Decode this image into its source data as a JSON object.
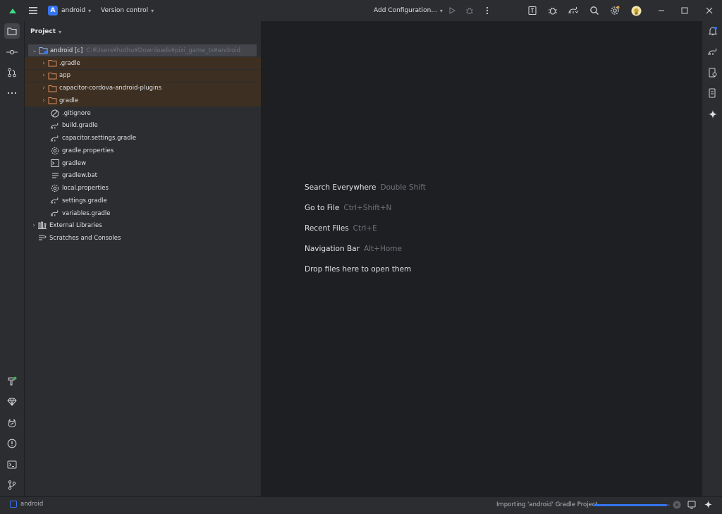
{
  "titlebar": {
    "project_letter": "A",
    "project_name": "android",
    "version_control": "Version control",
    "run_config": "Add Configuration..."
  },
  "project_panel": {
    "title": "Project",
    "root": {
      "label": "android [c]",
      "path": "C:¥Users¥hothu¥Downloads¥pixi_game_ts¥android"
    },
    "items": [
      {
        "label": ".gradle",
        "type": "folder"
      },
      {
        "label": "app",
        "type": "folder"
      },
      {
        "label": "capacitor-cordova-android-plugins",
        "type": "folder"
      },
      {
        "label": "gradle",
        "type": "folder"
      },
      {
        "label": ".gitignore",
        "type": "ignore"
      },
      {
        "label": "build.gradle",
        "type": "gradle"
      },
      {
        "label": "capacitor.settings.gradle",
        "type": "gradle"
      },
      {
        "label": "gradle.properties",
        "type": "properties"
      },
      {
        "label": "gradlew",
        "type": "shell"
      },
      {
        "label": "gradlew.bat",
        "type": "text"
      },
      {
        "label": "local.properties",
        "type": "properties"
      },
      {
        "label": "settings.gradle",
        "type": "gradle"
      },
      {
        "label": "variables.gradle",
        "type": "gradle"
      }
    ],
    "external_libraries": "External Libraries",
    "scratches": "Scratches and Consoles"
  },
  "editor": {
    "hints": [
      {
        "action": "Search Everywhere",
        "shortcut": "Double Shift"
      },
      {
        "action": "Go to File",
        "shortcut": "Ctrl+Shift+N"
      },
      {
        "action": "Recent Files",
        "shortcut": "Ctrl+E"
      },
      {
        "action": "Navigation Bar",
        "shortcut": "Alt+Home"
      },
      {
        "action": "Drop files here to open them",
        "shortcut": ""
      }
    ]
  },
  "statusbar": {
    "breadcrumb": "android",
    "task": "Importing 'android' Gradle Project",
    "progress": 0.96
  },
  "colors": {
    "accent": "#3574f0",
    "folder_excluded_bg": "#3d2f21",
    "folder_icon": "#d98c5f",
    "android_green": "#3ddc84"
  }
}
